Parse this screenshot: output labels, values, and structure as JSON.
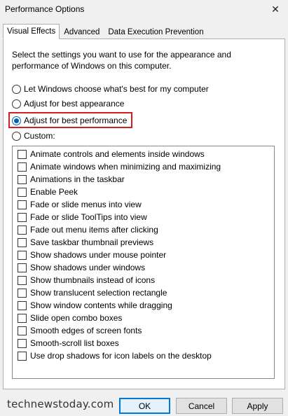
{
  "window": {
    "title": "Performance Options",
    "close_glyph": "✕"
  },
  "tabs": [
    {
      "label": "Visual Effects",
      "active": true
    },
    {
      "label": "Advanced",
      "active": false
    },
    {
      "label": "Data Execution Prevention",
      "active": false
    }
  ],
  "description": "Select the settings you want to use for the appearance and performance of Windows on this computer.",
  "options": [
    {
      "label": "Let Windows choose what's best for my computer",
      "checked": false
    },
    {
      "label": "Adjust for best appearance",
      "checked": false
    },
    {
      "label": "Adjust for best performance",
      "checked": true
    },
    {
      "label": "Custom:",
      "checked": false
    }
  ],
  "effects": [
    {
      "label": "Animate controls and elements inside windows",
      "checked": false
    },
    {
      "label": "Animate windows when minimizing and maximizing",
      "checked": false
    },
    {
      "label": "Animations in the taskbar",
      "checked": false
    },
    {
      "label": "Enable Peek",
      "checked": false
    },
    {
      "label": "Fade or slide menus into view",
      "checked": false
    },
    {
      "label": "Fade or slide ToolTips into view",
      "checked": false
    },
    {
      "label": "Fade out menu items after clicking",
      "checked": false
    },
    {
      "label": "Save taskbar thumbnail previews",
      "checked": false
    },
    {
      "label": "Show shadows under mouse pointer",
      "checked": false
    },
    {
      "label": "Show shadows under windows",
      "checked": false
    },
    {
      "label": "Show thumbnails instead of icons",
      "checked": false
    },
    {
      "label": "Show translucent selection rectangle",
      "checked": false
    },
    {
      "label": "Show window contents while dragging",
      "checked": false
    },
    {
      "label": "Slide open combo boxes",
      "checked": false
    },
    {
      "label": "Smooth edges of screen fonts",
      "checked": false
    },
    {
      "label": "Smooth-scroll list boxes",
      "checked": false
    },
    {
      "label": "Use drop shadows for icon labels on the desktop",
      "checked": false
    }
  ],
  "buttons": {
    "ok": "OK",
    "cancel": "Cancel",
    "apply": "Apply"
  },
  "watermark": "technewstoday.com",
  "colors": {
    "accent": "#0063b1",
    "highlight_border": "#d21f1f"
  }
}
